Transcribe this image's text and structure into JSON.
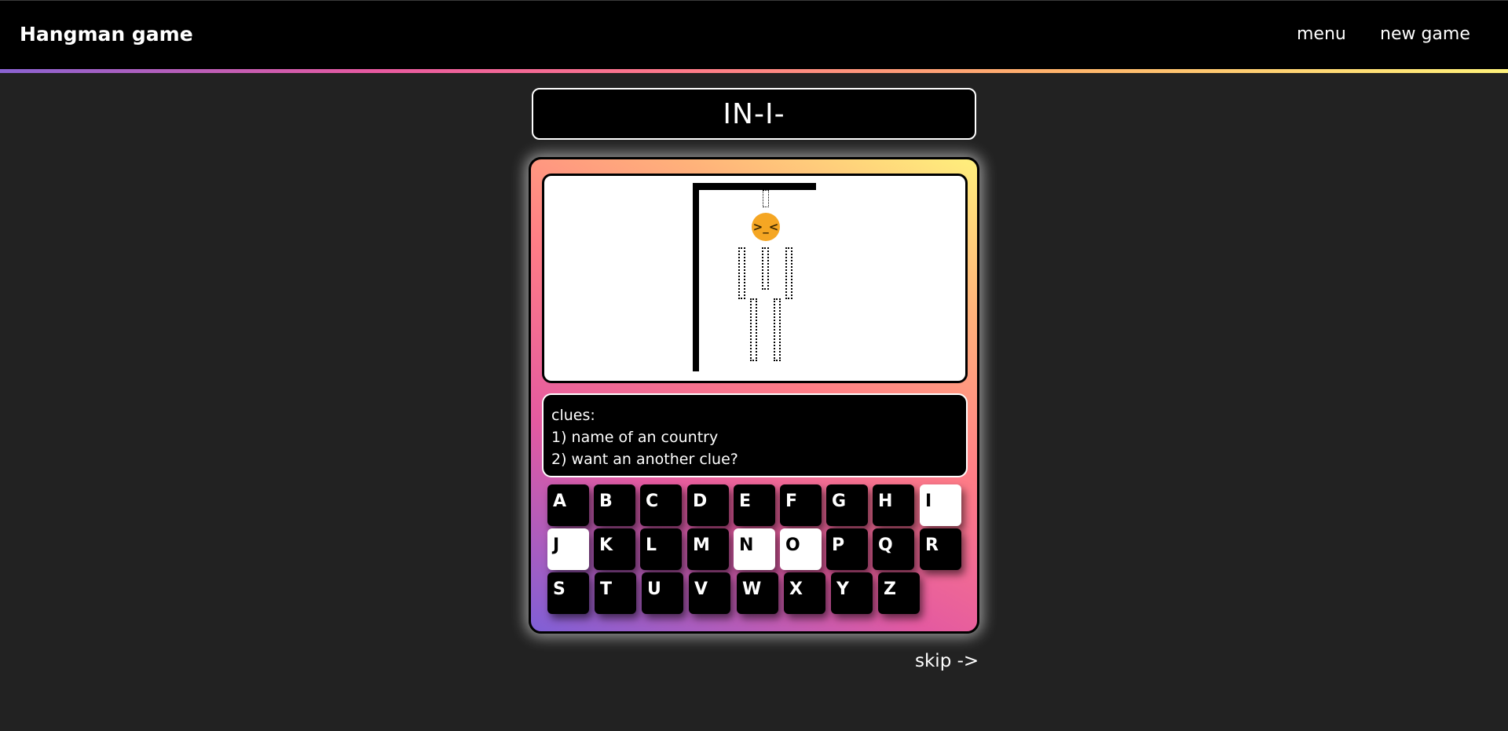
{
  "header": {
    "brand": "Hangman game",
    "nav": [
      "menu",
      "new game"
    ]
  },
  "word": "IN-I-",
  "hangman": {
    "face": ">_<",
    "face_color": "#f5a623"
  },
  "clues": {
    "title": "clues:",
    "items": [
      "1) name of an country",
      "2) want an another clue?"
    ]
  },
  "keyboard": {
    "rows": [
      [
        "A",
        "B",
        "C",
        "D",
        "E",
        "F",
        "G",
        "H",
        "I"
      ],
      [
        "J",
        "K",
        "L",
        "M",
        "N",
        "O",
        "P",
        "Q",
        "R"
      ],
      [
        "S",
        "T",
        "U",
        "V",
        "W",
        "X",
        "Y",
        "Z"
      ]
    ],
    "used": [
      "I",
      "J",
      "N",
      "O"
    ]
  },
  "skip_label": "skip ->",
  "colors": {
    "background": "#222222",
    "header": "#000000",
    "gradient": [
      "#8a63d2",
      "#e85aa0",
      "#ff7a8a",
      "#ffb36b",
      "#fff27a"
    ]
  }
}
